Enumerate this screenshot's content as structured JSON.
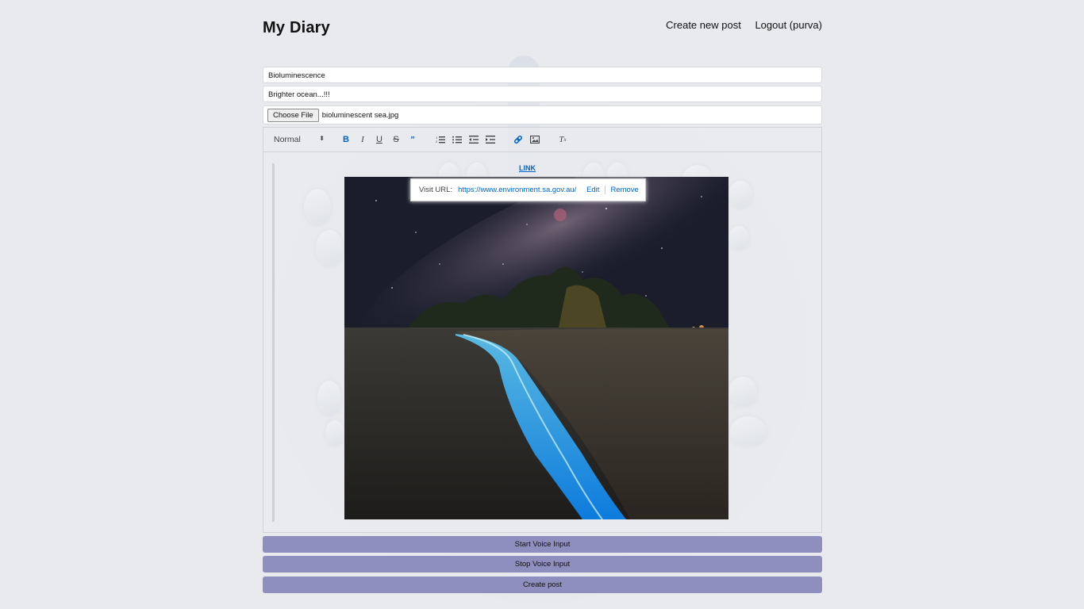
{
  "header": {
    "title": "My Diary",
    "nav": {
      "create_label": "Create new post",
      "logout_label": "Logout (purva)"
    }
  },
  "form": {
    "title_value": "Bioluminescence",
    "subtitle_value": "Brighter ocean...!!!",
    "file": {
      "button_label": "Choose File",
      "file_name": "bioluminescent sea.jpg"
    }
  },
  "editor": {
    "toolbar": {
      "header_select": "Normal",
      "buttons": [
        "bold-icon",
        "italic-icon",
        "underline-icon",
        "strike-icon",
        "blockquote-icon",
        "ordered-list-icon",
        "bullet-list-icon",
        "outdent-icon",
        "indent-icon",
        "link-icon",
        "image-icon",
        "clean-icon"
      ]
    },
    "link_text": "LINK",
    "tooltip": {
      "visit_label": "Visit URL:",
      "url": "https://www.environment.sa.gov.au/",
      "edit_label": "Edit",
      "remove_label": "Remove"
    },
    "colors": {
      "accent": "#0066cc",
      "button": "#8f8fbf"
    }
  },
  "buttons": {
    "start_voice": "Start Voice Input",
    "stop_voice": "Stop Voice Input",
    "create_post": "Create post"
  }
}
